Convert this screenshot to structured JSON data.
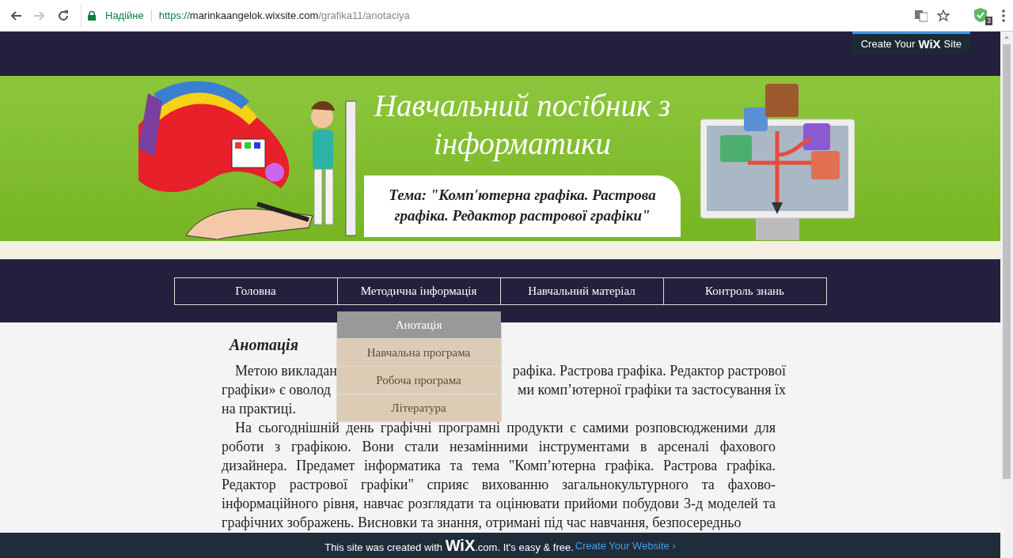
{
  "browser": {
    "forward_disabled": true,
    "secure_label": "Надійне",
    "url_scheme": "https://",
    "url_host": "marinkaangelok.wixsite.com",
    "url_path": "/grafika11/anotaciya",
    "extension_badge": "3"
  },
  "wix_top_button": {
    "label_before": "Create Your",
    "logo": "WiX",
    "label_after": "Site"
  },
  "banner": {
    "title": "Навчальний посібник з інформатики",
    "subtitle": "Тема:  \"Комп'ютерна графіка. Растрова графіка. Редактор растрової графіки\""
  },
  "nav": [
    {
      "label": "Головна"
    },
    {
      "label": "Методична інформація",
      "submenu": [
        {
          "label": "Анотація",
          "selected": true
        },
        {
          "label": "Навчальна програма",
          "selected": false
        },
        {
          "label": "Робоча програма",
          "selected": false
        },
        {
          "label": "Література",
          "selected": false
        }
      ]
    },
    {
      "label": "Навчальний матеріал"
    },
    {
      "label": "Контроль знань"
    }
  ],
  "content": {
    "heading": "Анотація",
    "paragraph_1_lines": [
      {
        "left": "Метою викладан",
        "right": "рафіка. Растрова графіка. Редактор растрової"
      },
      {
        "left": "графіки» є оволод",
        "right": "ми комп’ютерної графіки та застосування їх"
      },
      {
        "left": "на практиці."
      }
    ],
    "paragraph_2": "На сьогоднішній день графічні програмні продукти є самими розповсюдженими для роботи з графікою. Вони стали незамінними інструментами в арсеналі фахового дизайнера. Предамет інформатика та тема \"Комп’ютерна графіка. Растрова графіка. Редактор растрової графіки\" сприяє вихованню загальнокультурного та фахово-інформаційного рівня, навчає розглядати та оцінювати прийоми побудови 3-д моделей та графічних зображень. Висновки та знання, отримані під час навчання, безпосередньо"
  },
  "footer_bar": {
    "text_before": "This site was created with",
    "logo": "WiX",
    ".com_text": ".com. It's easy & free.",
    "link": "Create Your Website ›"
  }
}
